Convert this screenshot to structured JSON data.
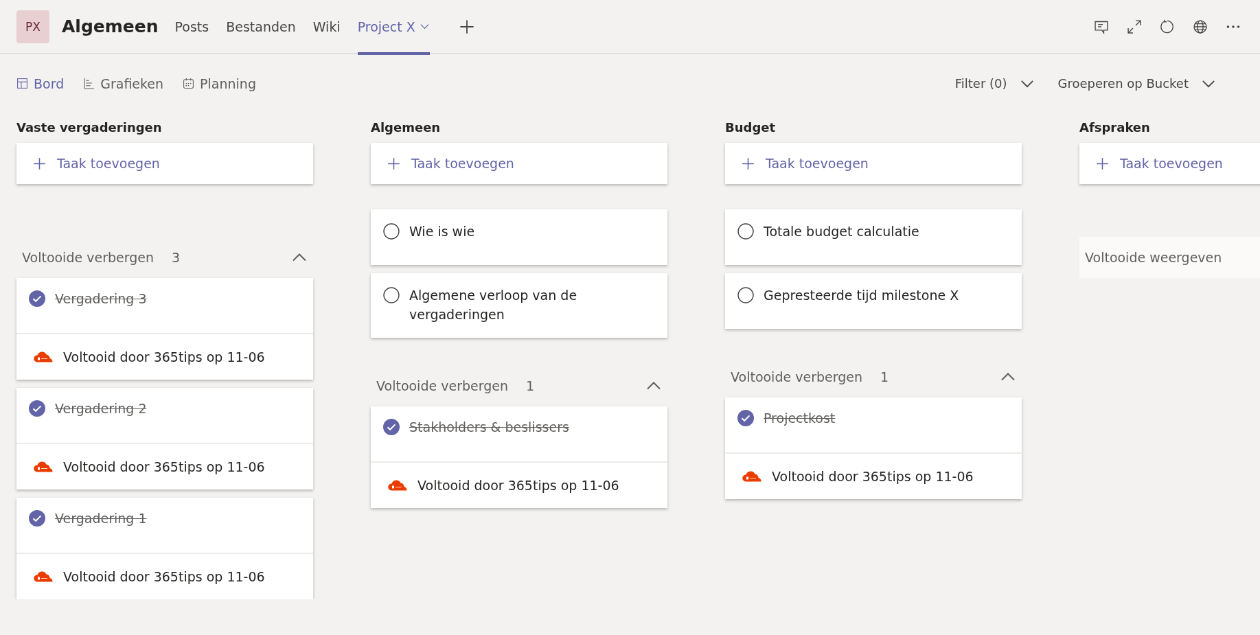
{
  "header": {
    "avatar": "PX",
    "title": "Algemeen",
    "tabs": [
      {
        "label": "Posts",
        "selected": false,
        "has_menu": false
      },
      {
        "label": "Bestanden",
        "selected": false,
        "has_menu": false
      },
      {
        "label": "Wiki",
        "selected": false,
        "has_menu": false
      },
      {
        "label": "Project X",
        "selected": true,
        "has_menu": true
      }
    ]
  },
  "views": [
    {
      "kind": "board",
      "label": "Bord",
      "selected": true
    },
    {
      "kind": "charts",
      "label": "Grafieken",
      "selected": false
    },
    {
      "kind": "schedule",
      "label": "Planning",
      "selected": false
    }
  ],
  "filter": "Filter (0)",
  "group_by": "Groeperen op Bucket",
  "buckets": [
    {
      "name": "Vaste vergaderingen",
      "add_label": "Taak toevoegen",
      "completed_section": {
        "label": "Voltooide verbergen",
        "count": "3",
        "expanded": true,
        "tasks": [
          {
            "title": "Vergadering 3",
            "completed": true,
            "completed_by": "Voltooid door 365tips op 11-06"
          },
          {
            "title": "Vergadering 2",
            "completed": true,
            "completed_by": "Voltooid door 365tips op 11-06"
          },
          {
            "title": "Vergadering 1",
            "completed": true,
            "completed_by": "Voltooid door 365tips op 11-06"
          }
        ]
      }
    },
    {
      "name": "Algemeen",
      "add_label": "Taak toevoegen",
      "tasks": [
        {
          "title": "Wie is wie",
          "completed": false
        },
        {
          "title": "Algemene verloop van de vergaderingen",
          "completed": false
        }
      ],
      "completed_section": {
        "label": "Voltooide verbergen",
        "count": "1",
        "expanded": true,
        "tasks": [
          {
            "title": "Stakholders & beslissers",
            "completed": true,
            "completed_by": "Voltooid door 365tips op 11-06"
          }
        ]
      }
    },
    {
      "name": "Budget",
      "add_label": "Taak toevoegen",
      "tasks": [
        {
          "title": "Totale budget calculatie",
          "completed": false
        },
        {
          "title": "Gepresteerde tijd milestone X",
          "completed": false
        }
      ],
      "completed_section": {
        "label": "Voltooide verbergen",
        "count": "1",
        "expanded": true,
        "tasks": [
          {
            "title": "Projectkost",
            "completed": true,
            "completed_by": "Voltooid door 365tips op 11-06"
          }
        ]
      }
    },
    {
      "name": "Afspraken",
      "add_label": "Taak toevoegen",
      "completed_section": {
        "label": "Voltooide weergeven"
      }
    }
  ]
}
